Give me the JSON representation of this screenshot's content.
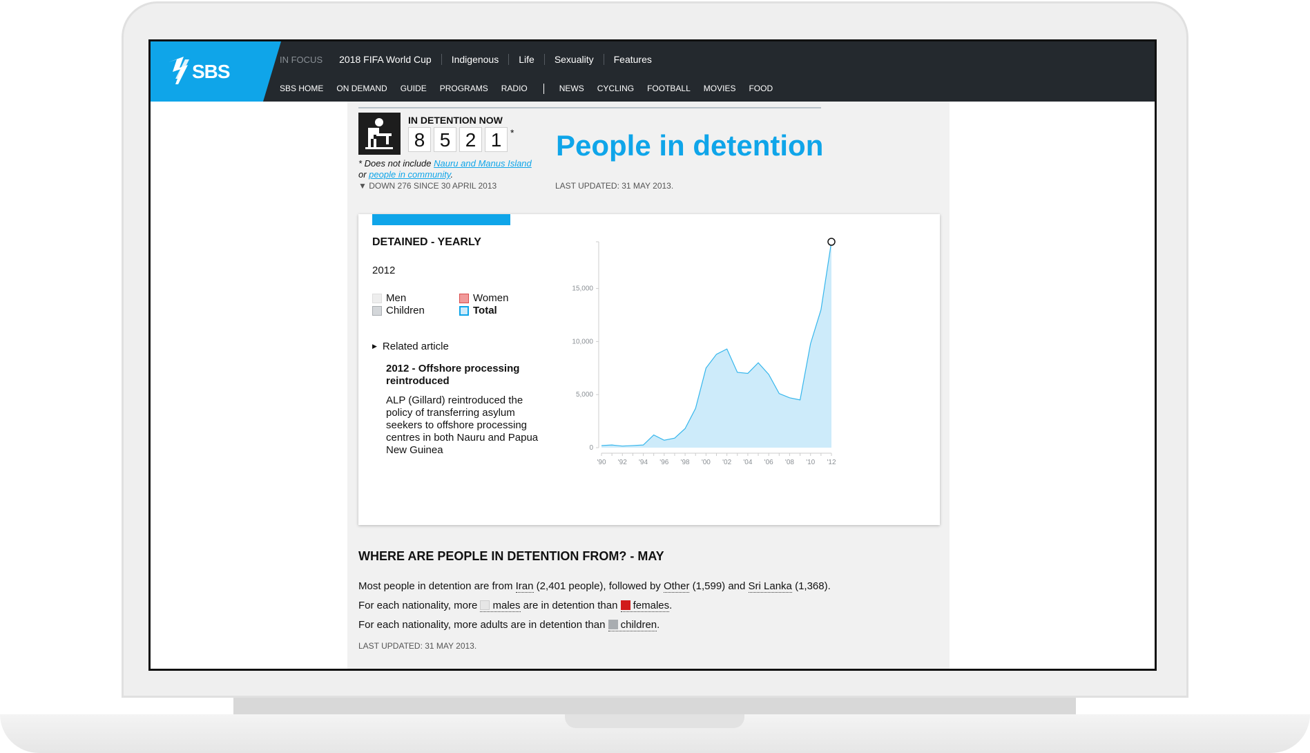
{
  "brand": {
    "logo_text": "SBS",
    "accent": "#0fa5e9",
    "header_bg": "#24292e"
  },
  "focus_bar": {
    "label": "IN FOCUS",
    "items": [
      "2018 FIFA World Cup",
      "Indigenous",
      "Life",
      "Sexuality",
      "Features"
    ]
  },
  "main_nav": {
    "primary": [
      "SBS HOME",
      "ON DEMAND",
      "GUIDE",
      "PROGRAMS",
      "RADIO"
    ],
    "secondary": [
      "NEWS",
      "CYCLING",
      "FOOTBALL",
      "MOVIES",
      "FOOD"
    ],
    "active": "NEWS"
  },
  "detention": {
    "label": "IN DETENTION NOW",
    "digits": [
      "8",
      "5",
      "2",
      "1"
    ],
    "star": "*",
    "footnote_prefix": "* Does not include ",
    "footnote_link1": "Nauru and Manus Island",
    "footnote_mid": "or ",
    "footnote_link2": "people in community",
    "footnote_end": ".",
    "trend": "▼ DOWN 276 SINCE 30 APRIL 2013"
  },
  "page_title": "People in detention",
  "last_updated_top": "LAST UPDATED: 31 MAY 2013.",
  "chart_panel": {
    "heading": "DETAINED - YEARLY",
    "selected_year": "2012",
    "legend": [
      {
        "label": "Men",
        "color": "#eeeeee",
        "border": "#dddddd"
      },
      {
        "label": "Women",
        "color": "#f19a9a",
        "border": "#d94c4c"
      },
      {
        "label": "Children",
        "color": "#d4d7da",
        "border": "#a9adb1"
      },
      {
        "label": "Total",
        "color": "#cdebfa",
        "border": "#0fa5e9"
      }
    ],
    "related_toggle": "Related article",
    "related_title": "2012 - Offshore processing reintroduced",
    "related_body": "ALP (Gillard) reintroduced the policy of transferring asylum seekers to offshore processing centres in both Nauru and Papua New Guinea"
  },
  "chart_data": {
    "type": "area",
    "title": "DETAINED - YEARLY",
    "xlabel": "",
    "ylabel": "",
    "x": [
      1990,
      1991,
      1992,
      1993,
      1994,
      1995,
      1996,
      1997,
      1998,
      1999,
      2000,
      2001,
      2002,
      2003,
      2004,
      2005,
      2006,
      2007,
      2008,
      2009,
      2010,
      2011,
      2012
    ],
    "series": [
      {
        "name": "Total",
        "values": [
          200,
          250,
          150,
          200,
          250,
          1200,
          700,
          900,
          1800,
          3700,
          7500,
          8800,
          9300,
          7100,
          7000,
          8000,
          6900,
          5100,
          4700,
          4500,
          9800,
          13000,
          19400
        ]
      }
    ],
    "x_tick_labels": [
      "'90",
      "'92",
      "'94",
      "'96",
      "'98",
      "'00",
      "'02",
      "'04",
      "'06",
      "'08",
      "'10",
      "'12"
    ],
    "x_tick_values": [
      1990,
      1992,
      1994,
      1996,
      1998,
      2000,
      2002,
      2004,
      2006,
      2008,
      2010,
      2012
    ],
    "y_tick_labels": [
      "0",
      "5,000",
      "10,000",
      "15,000"
    ],
    "y_tick_values": [
      0,
      5000,
      10000,
      15000
    ],
    "ylim": [
      0,
      19400
    ],
    "xlim": [
      1990,
      2012
    ],
    "highlight_x": 2012,
    "fill": "#cdebfa",
    "stroke": "#35b6ec",
    "grid": false
  },
  "nationality": {
    "heading": "WHERE ARE PEOPLE IN DETENTION FROM? - MAY",
    "line1": {
      "t1": "Most people in detention are from ",
      "c1": "Iran",
      "t2": " (2,401 people), followed by ",
      "c2": "Other",
      "t3": " (1,599) and ",
      "c3": "Sri Lanka",
      "t4": " (1,368)."
    },
    "line2": {
      "t1": "For each nationality, more ",
      "males": "males",
      "t2": " are in detention than ",
      "females": "females",
      "end": ".",
      "male_color": "#e6e6e6",
      "female_color": "#d11b1b"
    },
    "line3": {
      "t1": "For each nationality, more adults are in detention than ",
      "children": "children",
      "end": ".",
      "children_color": "#a9adb1"
    },
    "last_updated": "LAST UPDATED: 31 MAY 2013."
  }
}
